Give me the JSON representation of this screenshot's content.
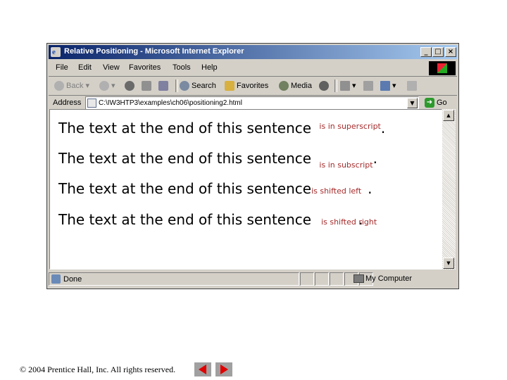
{
  "window": {
    "title": "Relative Positioning - Microsoft Internet Explorer",
    "minimize": "_",
    "maximize": "□",
    "close": "×"
  },
  "menu": [
    "File",
    "Edit",
    "View",
    "Favorites",
    "Tools",
    "Help"
  ],
  "toolbar": {
    "back": "Back",
    "search": "Search",
    "favorites": "Favorites",
    "media": "Media"
  },
  "address": {
    "label": "Address",
    "value": "C:\\IW3HTP3\\examples\\ch06\\positioning2.html",
    "go": "Go"
  },
  "content": {
    "lines": [
      {
        "main": "The text at the end of this sentence",
        "special": "is in superscript",
        "end": "."
      },
      {
        "main": "The text at the end of this sentence",
        "special": "is in subscript",
        "end": "."
      },
      {
        "main": "The text at the end of this sentence",
        "special": "is shifted left",
        "end": "."
      },
      {
        "main": "The text at the end of this sentence",
        "special": "is shifted right",
        "end": "."
      }
    ]
  },
  "status": {
    "left": "Done",
    "zone": "My Computer"
  },
  "footer": {
    "copyright": "© 2004 Prentice Hall, Inc.  All rights reserved."
  },
  "colors": {
    "special_text": "#a52a2a",
    "titlebar_start": "#0a246a",
    "titlebar_end": "#a6caf0",
    "chrome": "#d4d0c8",
    "nav_arrow": "#e00000"
  }
}
